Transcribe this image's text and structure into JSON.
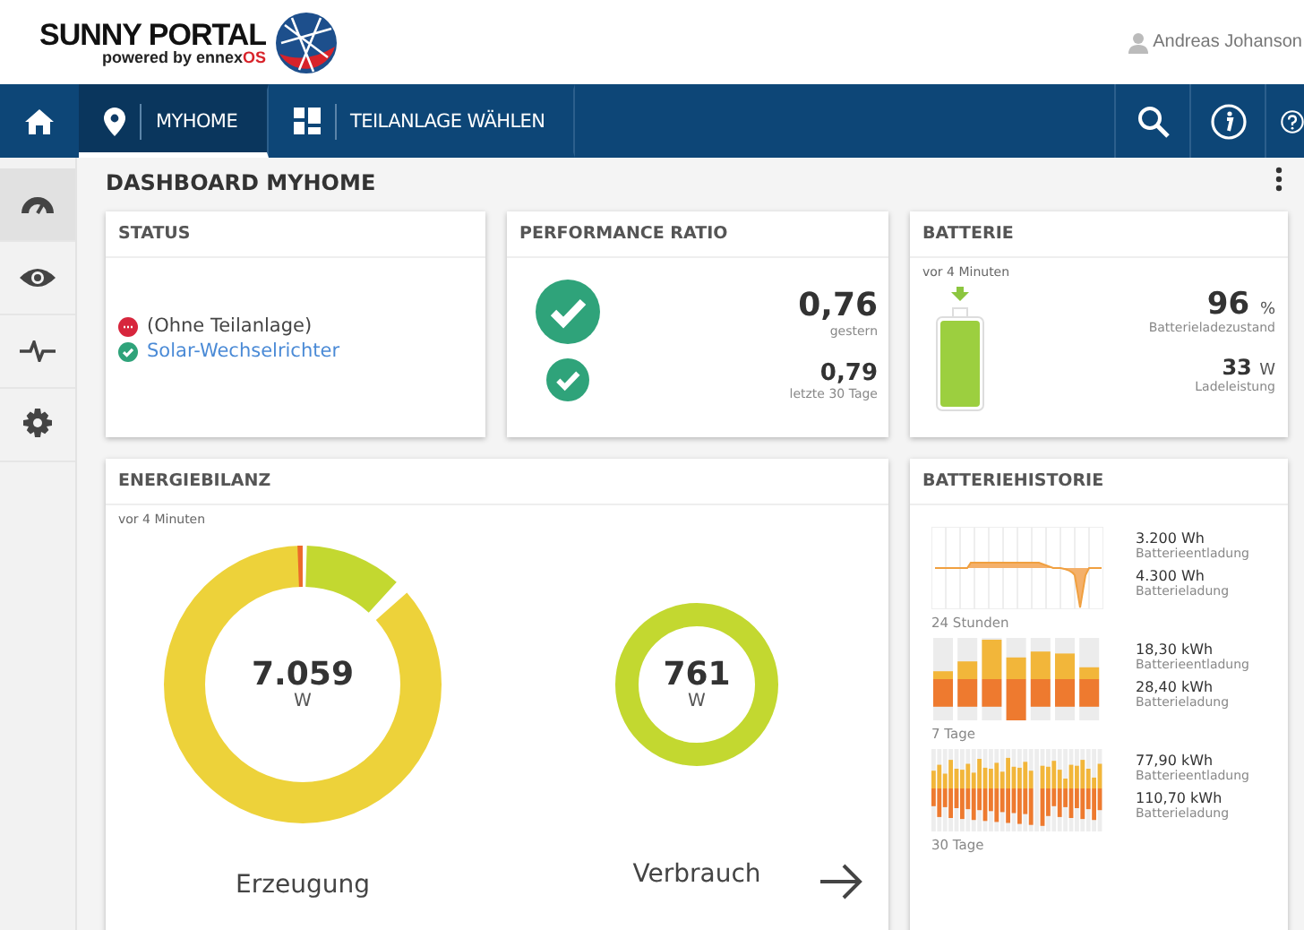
{
  "header": {
    "logo_title": "SUNNY PORTAL",
    "logo_subtitle": "powered by ennex",
    "logo_subtitle_accent": "OS",
    "user": "Andreas Johanson"
  },
  "nav": {
    "tabs": [
      {
        "label": "MYHOME",
        "kind": "location",
        "selected": true
      },
      {
        "label": "TEILANLAGE WÄHLEN",
        "kind": "grid",
        "selected": false
      }
    ]
  },
  "sidebar": {
    "items": [
      {
        "kind": "gauge",
        "selected": true
      },
      {
        "kind": "eye",
        "selected": false
      },
      {
        "kind": "pulse",
        "selected": false
      },
      {
        "kind": "gear",
        "selected": false
      }
    ]
  },
  "page_title": "DASHBOARD MYHOME",
  "status": {
    "title": "STATUS",
    "items": [
      {
        "kind": "error",
        "label": "(Ohne Teilanlage)",
        "link": false
      },
      {
        "kind": "ok",
        "label": "Solar-Wechselrichter",
        "link": true
      }
    ]
  },
  "performance": {
    "title": "PERFORMANCE RATIO",
    "rows": [
      {
        "value": "0,76",
        "caption": "gestern"
      },
      {
        "value": "0,79",
        "caption": "letzte 30 Tage"
      }
    ]
  },
  "battery": {
    "title": "BATTERIE",
    "updated": "vor 4 Minuten",
    "charge": {
      "value": "96",
      "unit": "%",
      "caption": "Batterieladezustand"
    },
    "power": {
      "value": "33",
      "unit": "W",
      "caption": "Ladeleistung"
    }
  },
  "energy": {
    "title": "ENERGIEBILANZ",
    "updated": "vor 4 Minuten",
    "generation": {
      "value": "7.059",
      "unit": "W",
      "label": "Erzeugung"
    },
    "consumption": {
      "value": "761",
      "unit": "W",
      "label": "Verbrauch"
    }
  },
  "history": {
    "title": "BATTERIEHISTORIE",
    "periods": [
      {
        "kind": "line",
        "label": "24 Stunden",
        "discharge": "3.200 Wh",
        "discharge_caption": "Batterieentladung",
        "charge": "4.300 Wh",
        "charge_caption": "Batterieladung"
      },
      {
        "kind": "week",
        "label": "7 Tage",
        "discharge": "18,30 kWh",
        "discharge_caption": "Batterieentladung",
        "charge": "28,40 kWh",
        "charge_caption": "Batterieladung"
      },
      {
        "kind": "month",
        "label": "30 Tage",
        "discharge": "77,90 kWh",
        "discharge_caption": "Batterieentladung",
        "charge": "110,70 kWh",
        "charge_caption": "Batterieladung"
      }
    ]
  }
}
